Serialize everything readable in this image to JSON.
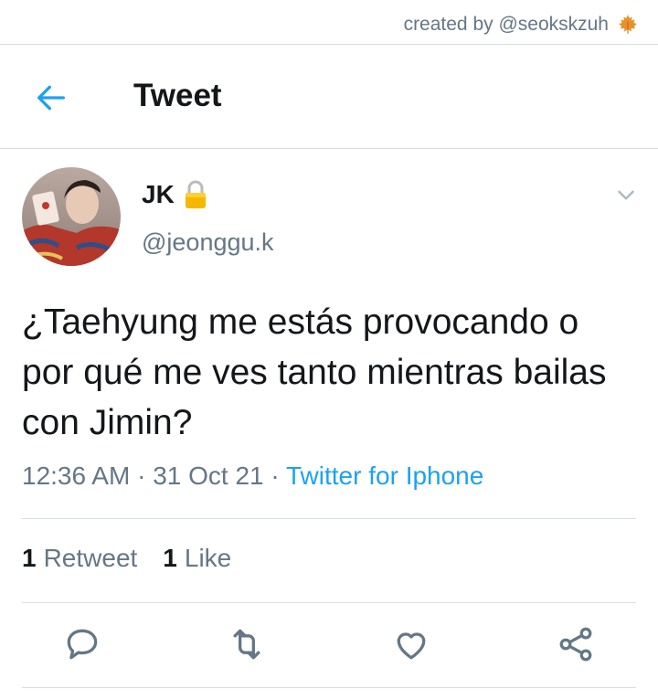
{
  "credit": {
    "text": "created by @seokskzuh",
    "icon": "maple-leaf-icon"
  },
  "header": {
    "title": "Tweet",
    "back_icon": "arrow-left-icon"
  },
  "tweet": {
    "display_name": "JK",
    "handle": "@jeonggu.k",
    "locked_icon": "lock-icon",
    "text": "¿Taehyung me estás provocando o por qué me ves tanto mientras bailas con Jimin?",
    "time": "12:36 AM",
    "sep1": " · ",
    "date": "31 Oct 21",
    "sep2": " · ",
    "source": "Twitter for Iphone"
  },
  "stats": {
    "retweets_count": "1",
    "retweets_label": "Retweet",
    "likes_count": "1",
    "likes_label": "Like"
  },
  "actions": [
    "reply-icon",
    "retweet-icon",
    "like-icon",
    "share-icon"
  ],
  "colors": {
    "accent": "#1da1f2",
    "muted": "#657786",
    "text": "#14171a",
    "divider": "#d8dde2",
    "lock": "#f5b800"
  }
}
